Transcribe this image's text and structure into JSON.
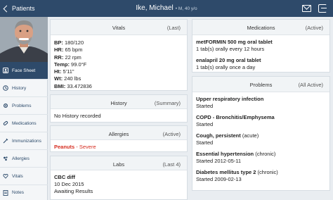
{
  "header": {
    "back_label": "Patients",
    "patient_name": "Ike, Michael",
    "patient_meta": "• M, 40 y/o"
  },
  "sidebar": {
    "items": [
      {
        "label": "Face Sheet",
        "icon": "face-sheet-icon",
        "active": true
      },
      {
        "label": "History",
        "icon": "history-icon"
      },
      {
        "label": "Problems",
        "icon": "problems-icon"
      },
      {
        "label": "Medications",
        "icon": "medications-icon"
      },
      {
        "label": "Immunizations",
        "icon": "immunizations-icon"
      },
      {
        "label": "Allergies",
        "icon": "allergies-icon"
      },
      {
        "label": "Vitals",
        "icon": "vitals-icon"
      },
      {
        "label": "Notes",
        "icon": "notes-icon"
      }
    ]
  },
  "vitals": {
    "title": "Vitals",
    "count": "(Last)",
    "rows": [
      {
        "label": "BP:",
        "value": "180/120"
      },
      {
        "label": "HR:",
        "value": "65 bpm"
      },
      {
        "label": "RR:",
        "value": "22 rpm"
      },
      {
        "label": "Temp:",
        "value": "99.0°F"
      },
      {
        "label": "Ht:",
        "value": "5'11\""
      },
      {
        "label": "Wt:",
        "value": "240 lbs"
      },
      {
        "label": "BMI:",
        "value": "33.472836"
      }
    ]
  },
  "history": {
    "title": "History",
    "count": "(Summary)",
    "text": "No History recorded"
  },
  "allergies": {
    "title": "Allergies",
    "count": "(Active)",
    "name": "Peanuts",
    "severity": " - Severe"
  },
  "labs": {
    "title": "Labs",
    "count": "(Last 4)",
    "name": "CBC diff",
    "date": "10 Dec 2015",
    "status": "Awaiting Results"
  },
  "medications": {
    "title": "Medications",
    "count": "(Active)",
    "items": [
      {
        "name": "metFORMIN 500 mg oral tablet",
        "sig": "1 tab(s) orally every 12 hours"
      },
      {
        "name": "enalapril 20 mg oral tablet",
        "sig": "1 tab(s) orally once a day"
      }
    ]
  },
  "problems": {
    "title": "Problems",
    "count": "(All Active)",
    "items": [
      {
        "name": "Upper respiratory infection",
        "qual": "",
        "status": "Started"
      },
      {
        "name": "COPD - Bronchitis/Emphysema",
        "qual": "",
        "status": "Started"
      },
      {
        "name": "Cough, persistent",
        "qual": " (acute)",
        "status": "Started"
      },
      {
        "name": "Essential hypertension",
        "qual": " (chronic)",
        "status": "Started 2012-05-11"
      },
      {
        "name": "Diabetes mellitus type 2",
        "qual": " (chronic)",
        "status": "Started 2009-02-13"
      }
    ]
  }
}
